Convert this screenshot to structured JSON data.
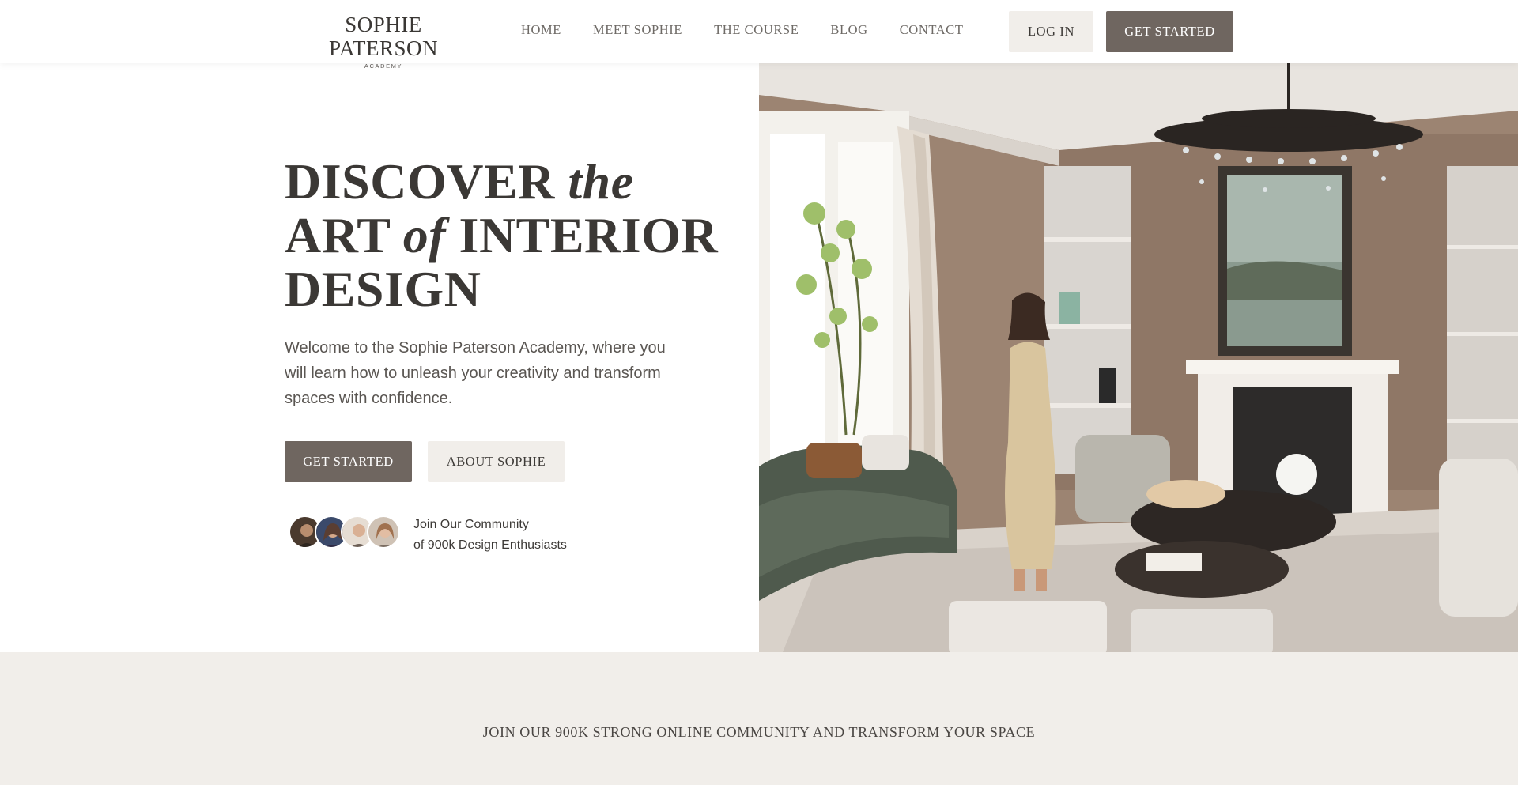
{
  "header": {
    "logo_name": "SOPHIE PATERSON",
    "logo_sub": "ACADEMY",
    "nav": [
      "HOME",
      "MEET SOPHIE",
      "THE COURSE",
      "BLOG",
      "CONTACT"
    ],
    "login_label": "LOG IN",
    "get_started_label": "GET STARTED"
  },
  "hero": {
    "headline": {
      "line1_word": "DISCOVER",
      "line1_italic": "the",
      "line2_word": "ART",
      "line2_italic": "of",
      "line2_word2": "INTERIOR",
      "line3_word": "DESIGN"
    },
    "lead": "Welcome to the Sophie Paterson Academy, where you will learn how to unleash your creativity and transform spaces with confidence.",
    "get_started_label": "GET STARTED",
    "about_label": "ABOUT SOPHIE",
    "community_line1": "Join Our Community",
    "community_line2": "of 900k Design Enthusiasts",
    "image_icon": "interior-living-room-photo"
  },
  "band": {
    "text": "JOIN OUR 900K STRONG ONLINE COMMUNITY AND TRANSFORM YOUR SPACE"
  },
  "colors": {
    "accent_dark": "#6f6660",
    "accent_light": "#f1eeea",
    "text": "#3d3a37"
  }
}
